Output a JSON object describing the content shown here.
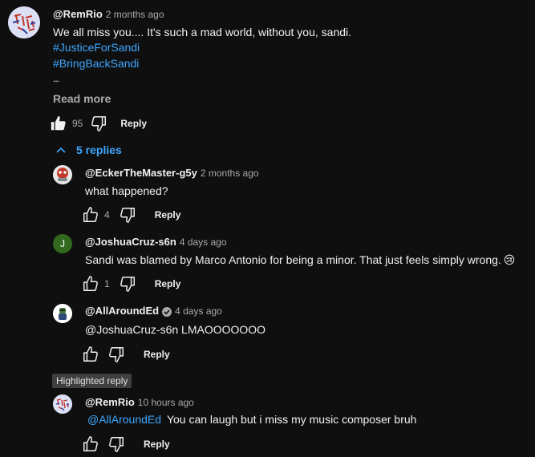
{
  "comment": {
    "author": "@RemRio",
    "time": "2 months ago",
    "text": "We all miss you.... It's such a mad world, without you, sandi.",
    "hashtags": [
      "#JusticeForSandi",
      "#BringBackSandi"
    ],
    "ellipsis": "...",
    "read_more": "Read more",
    "likes": "95",
    "reply_label": "Reply"
  },
  "replies_toggle": "5 replies",
  "replies": [
    {
      "author": "@EckerTheMaster-g5y",
      "time": "2 months ago",
      "text": "what happened?",
      "likes": "4",
      "reply_label": "Reply"
    },
    {
      "author": "@JoshuaCruz-s6n",
      "time": "4 days ago",
      "text": "Sandi was blamed by Marco Antonio for being a minor. That just feels simply wrong.",
      "emoji": "😢",
      "likes": "1",
      "reply_label": "Reply",
      "avatar_letter": "J"
    },
    {
      "author": "@AllAroundEd",
      "time": "4 days ago",
      "text": "@JoshuaCruz-s6n LMAOOOOOOO",
      "likes": "",
      "reply_label": "Reply"
    },
    {
      "author": "@RemRio",
      "time": "10 hours ago",
      "mention": "@AllAroundEd",
      "text": "You can laugh but i miss my music composer bruh",
      "likes": "",
      "reply_label": "Reply"
    }
  ],
  "highlighted_badge": "Highlighted reply",
  "colors": {
    "background": "#0f0f0f",
    "link": "#3ea6ff",
    "muted": "#aaaaaa",
    "verified": "#aaaaaa"
  }
}
